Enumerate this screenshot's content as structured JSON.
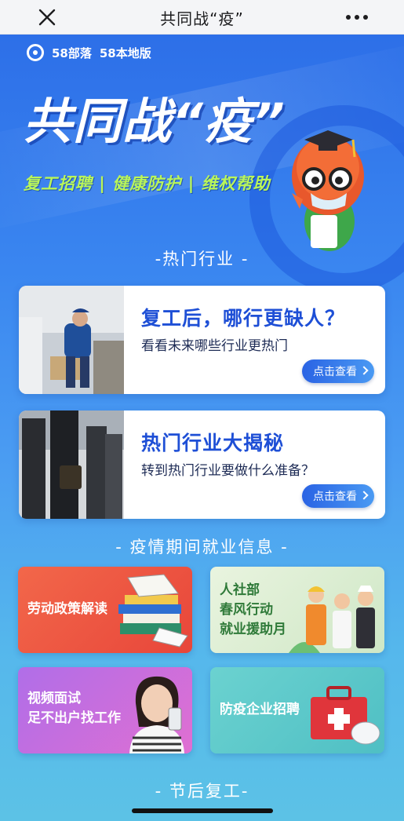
{
  "nav": {
    "title": "共同战“疫”"
  },
  "brand": {
    "name1": "58部落",
    "name2": "58本地版"
  },
  "hero": {
    "title": "共同战“疫”",
    "subtitle": "复工招聘 | 健康防护 | 维权帮助"
  },
  "sections": {
    "hot_industry": "-热门行业 -",
    "employment_info": "- 疫情期间就业信息 -",
    "after_holiday": "- 节后复工-"
  },
  "features": [
    {
      "heading": "复工后，哪行更缺人？",
      "desc": "看看未来哪些行业更热门",
      "button": "点击查看"
    },
    {
      "heading": "热门行业大揭秘",
      "desc": "转到热门行业要做什么准备？",
      "button": "点击查看"
    }
  ],
  "tiles": [
    {
      "label": "劳动政策解读"
    },
    {
      "lines": [
        "人社部",
        "春风行动",
        "就业援助月"
      ]
    },
    {
      "lines": [
        "视频面试",
        "足不出户找工作"
      ]
    },
    {
      "label": "防疫企业招聘"
    }
  ]
}
